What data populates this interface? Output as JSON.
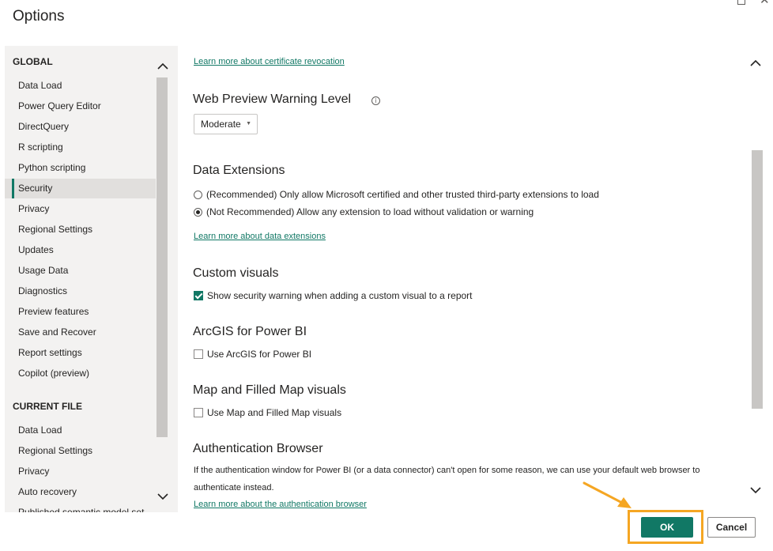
{
  "window": {
    "title": "Options"
  },
  "sidebar": {
    "global_heading": "GLOBAL",
    "global_items": [
      {
        "label": "Data Load"
      },
      {
        "label": "Power Query Editor"
      },
      {
        "label": "DirectQuery"
      },
      {
        "label": "R scripting"
      },
      {
        "label": "Python scripting"
      },
      {
        "label": "Security",
        "active": true
      },
      {
        "label": "Privacy"
      },
      {
        "label": "Regional Settings"
      },
      {
        "label": "Updates"
      },
      {
        "label": "Usage Data"
      },
      {
        "label": "Diagnostics"
      },
      {
        "label": "Preview features"
      },
      {
        "label": "Save and Recover"
      },
      {
        "label": "Report settings"
      },
      {
        "label": "Copilot (preview)"
      }
    ],
    "current_heading": "CURRENT FILE",
    "current_items": [
      {
        "label": "Data Load"
      },
      {
        "label": "Regional Settings"
      },
      {
        "label": "Privacy"
      },
      {
        "label": "Auto recovery"
      },
      {
        "label": "Published semantic model set..."
      }
    ]
  },
  "content": {
    "cert_link": "Learn more about certificate revocation",
    "web_preview": {
      "heading": "Web Preview Warning Level",
      "info_icon": "info-icon",
      "dropdown_value": "Moderate"
    },
    "data_extensions": {
      "heading": "Data Extensions",
      "options": [
        {
          "label": "(Recommended) Only allow Microsoft certified and other trusted third-party extensions to load",
          "selected": false
        },
        {
          "label": "(Not Recommended) Allow any extension to load without validation or warning",
          "selected": true
        }
      ],
      "link": "Learn more about data extensions"
    },
    "custom_visuals": {
      "heading": "Custom visuals",
      "checkbox_label": "Show security warning when adding a custom visual to a report",
      "checked": true
    },
    "arcgis": {
      "heading": "ArcGIS for Power BI",
      "checkbox_label": "Use ArcGIS for Power BI",
      "checked": false
    },
    "map_visuals": {
      "heading": "Map and Filled Map visuals",
      "checkbox_label": "Use Map and Filled Map visuals",
      "checked": false
    },
    "auth_browser": {
      "heading": "Authentication Browser",
      "description": "If the authentication window for Power BI (or a data connector) can't open for some reason, we can use your default web browser to authenticate instead.",
      "link": "Learn more about the authentication browser"
    }
  },
  "footer": {
    "ok_label": "OK",
    "cancel_label": "Cancel"
  },
  "colors": {
    "accent": "#117865",
    "highlight": "#f5a623"
  }
}
